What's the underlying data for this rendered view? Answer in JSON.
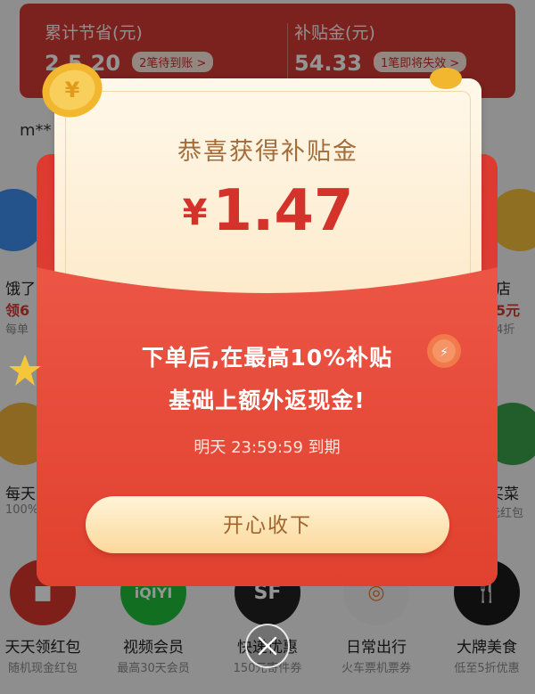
{
  "summary": {
    "saved_label": "累计节省(元)",
    "saved_value": "2.5.20",
    "saved_badge": "2笔待到账 >",
    "subsidy_label": "补贴金(元)",
    "subsidy_value": "54.33",
    "subsidy_badge": "1笔即将失效 >"
  },
  "user_masked": "m**",
  "side_left": {
    "name": "饿了",
    "promo": "领6",
    "sub": "每单"
  },
  "side_left2": {
    "name": "每天",
    "sub": "100%"
  },
  "side_right": {
    "name": "店",
    "promo": "5元",
    "sub": "4折"
  },
  "side_right2": {
    "name": "买菜",
    "sub": "元红包"
  },
  "grid": [
    {
      "label": "天天领红包",
      "sub": "随机现金红包",
      "icon": "red-envelope-icon",
      "color": "#d9362e"
    },
    {
      "label": "视频会员",
      "sub": "最高30天会员",
      "icon": "iqiyi-icon",
      "color": "#1fbf3a"
    },
    {
      "label": "快递优惠",
      "sub": "150元寄件券",
      "icon": "express-icon",
      "color": "#222222"
    },
    {
      "label": "日常出行",
      "sub": "火车票机票券",
      "icon": "travel-icon",
      "color": "#f0f0f0"
    },
    {
      "label": "大牌美食",
      "sub": "低至5折优惠",
      "icon": "food-icon",
      "color": "#1a1a1a"
    }
  ],
  "modal": {
    "title": "恭喜获得补贴金",
    "currency": "¥",
    "amount": "1.47",
    "desc_line1": "下单后,在最高10%补贴",
    "desc_line2": "基础上额外返现金!",
    "expire": "明天 23:59:59 到期",
    "accept_label": "开心收下"
  },
  "colors": {
    "primary_red": "#d43a34",
    "envelope_red": "#e14437",
    "gold_text": "#a36d3b",
    "amount_red": "#d4332b"
  }
}
